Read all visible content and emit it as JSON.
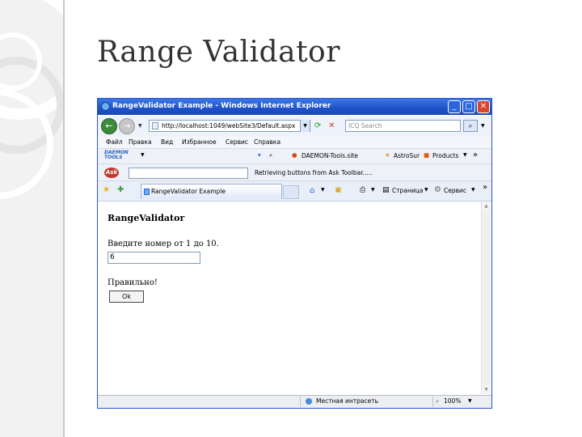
{
  "slide": {
    "title": "Range Validator"
  },
  "window": {
    "title": "RangeValidator Example - Windows Internet Explorer",
    "controls": {
      "minimize": "_",
      "maximize": "□",
      "close": "✕"
    }
  },
  "navbar": {
    "back_icon": "←",
    "forward_icon": "→",
    "address": "http://localhost:1049/webSite3/Default.aspx",
    "search_placeholder": "ICQ Search"
  },
  "menu": [
    "Файл",
    "Правка",
    "Вид",
    "Избранное",
    "Сервис",
    "Справка"
  ],
  "toolbar1": {
    "logo": "DAEMON TOOLS",
    "site_label": "DAEMON-Tools.site",
    "astro_label": "AstroSur",
    "products_label": "Products",
    "more": "»"
  },
  "toolbar2": {
    "ask_logo": "Ask",
    "status_text": "Retrieving buttons from Ask Toolbar....."
  },
  "toolbar3": {
    "tab_title": "RangeValidator Example",
    "page_label": "Страница",
    "tools_label": "Сервис",
    "more": "»"
  },
  "page": {
    "heading": "RangeValidator",
    "prompt": "Введите номер от 1 до 10.",
    "input_value": "6",
    "result": "Правильно!",
    "ok_button": "Ok"
  },
  "statusbar": {
    "zone": "Местная интрасеть",
    "zoom": "100%"
  }
}
